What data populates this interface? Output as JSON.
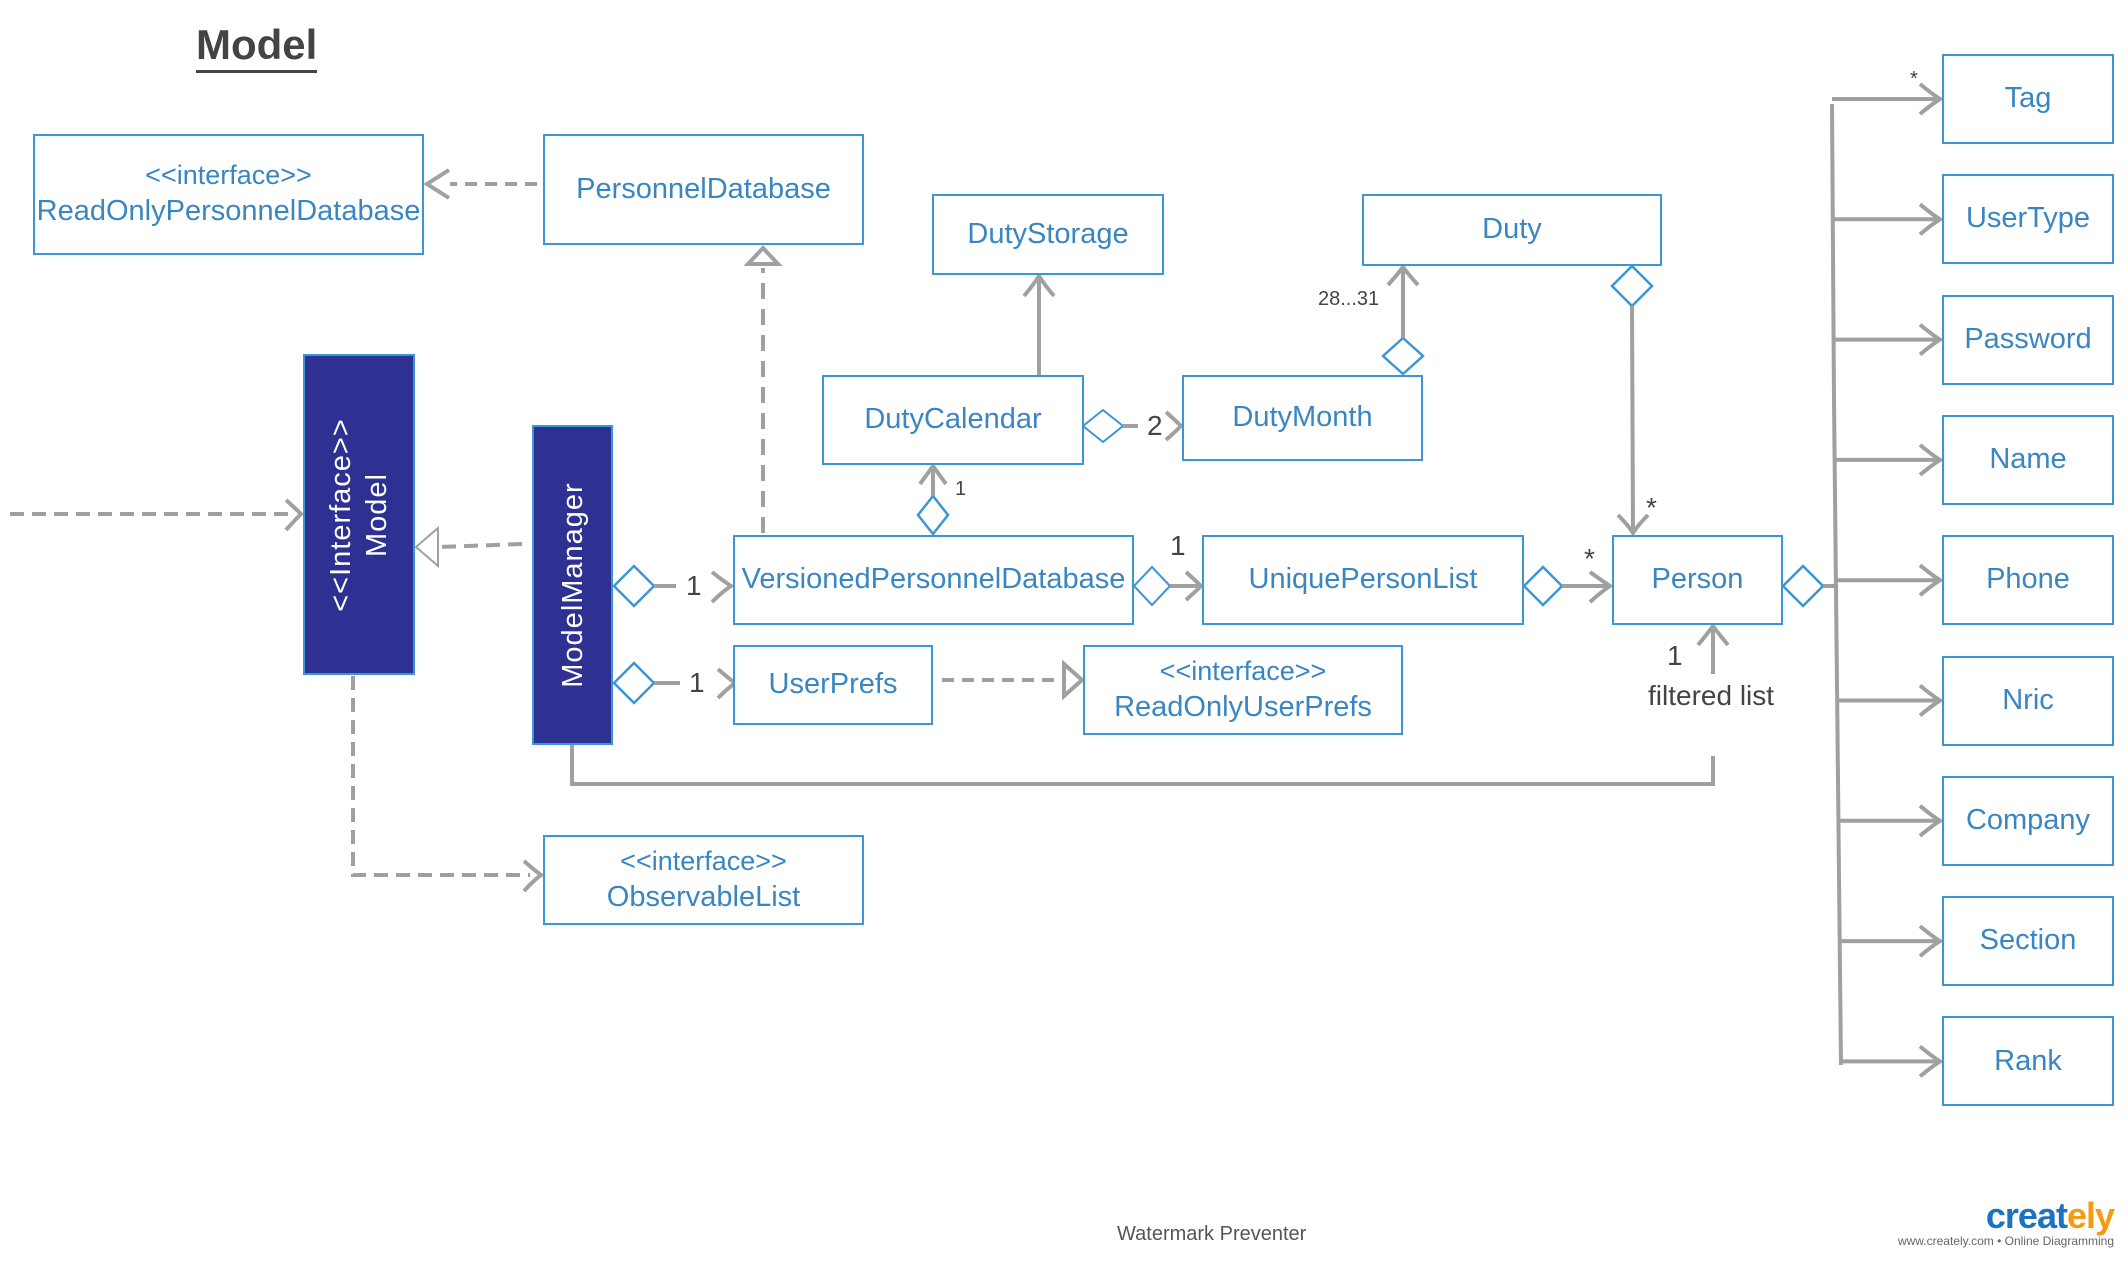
{
  "diagram": {
    "title": "Model",
    "colors": {
      "class_border": "#3a96d6",
      "class_text": "#3a86c2",
      "dark_fill": "#2e3192",
      "connector": "#a0a0a0",
      "label_text": "#444444"
    },
    "classes": {
      "read_only_personnel_database": {
        "stereotype": "<<interface>>",
        "name": "ReadOnlyPersonnelDatabase"
      },
      "personnel_database": {
        "name": "PersonnelDatabase"
      },
      "duty_storage": {
        "name": "DutyStorage"
      },
      "duty": {
        "name": "Duty"
      },
      "duty_calendar": {
        "name": "DutyCalendar"
      },
      "duty_month": {
        "name": "DutyMonth"
      },
      "model_interface": {
        "stereotype": "<<Interface>>",
        "name": "Model"
      },
      "model_manager": {
        "name": "ModelManager"
      },
      "versioned_personnel_database": {
        "name": "VersionedPersonnelDatabase"
      },
      "unique_person_list": {
        "name": "UniquePersonList"
      },
      "person": {
        "name": "Person"
      },
      "user_prefs": {
        "name": "UserPrefs"
      },
      "read_only_user_prefs": {
        "stereotype": "<<interface>>",
        "name": "ReadOnlyUserPrefs"
      },
      "observable_list": {
        "stereotype": "<<interface>>",
        "name": "ObservableList"
      }
    },
    "person_attributes": [
      "Tag",
      "UserType",
      "Password",
      "Name",
      "Phone",
      "Nric",
      "Company",
      "Section",
      "Rank"
    ],
    "multiplicities": {
      "tag": "*",
      "duty_month_to_duty": "28...31",
      "calendar_to_month": "2",
      "vpd_to_calendar": "1",
      "vpd_to_upl": "1",
      "mm_to_vpd": "1",
      "mm_to_userprefs": "1",
      "upl_to_person": "*",
      "duty_to_person": "*",
      "filtered_list_mult": "1"
    },
    "labels": {
      "filtered_list": "filtered list"
    }
  },
  "footer": {
    "watermark": "Watermark Preventer",
    "logo_brand_main": "creat",
    "logo_brand_accent": "ely",
    "logo_tagline": "www.creately.com • Online Diagramming"
  }
}
